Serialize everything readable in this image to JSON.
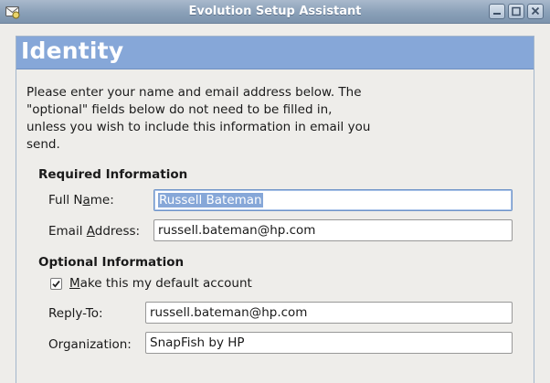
{
  "window": {
    "title": "Evolution Setup Assistant",
    "icons": {
      "app": "evolution-app-icon",
      "minimize": "minimize-icon",
      "maximize": "maximize-icon",
      "close": "close-icon"
    }
  },
  "page": {
    "title": "Identity",
    "intro_lines": [
      "Please enter your name and email address below. The",
      "\"optional\" fields below do not need to be filled in,",
      "unless you wish to include this information in email you",
      "send."
    ]
  },
  "required": {
    "heading": "Required Information",
    "full_name": {
      "label_prefix": "Full N",
      "label_mnemonic": "a",
      "label_suffix": "me:",
      "value": "Russell Bateman"
    },
    "email": {
      "label_prefix": "Email ",
      "label_mnemonic": "A",
      "label_suffix": "ddress:",
      "value": "russell.bateman@hp.com"
    }
  },
  "optional": {
    "heading": "Optional Information",
    "default_account": {
      "label_mnemonic": "M",
      "label_suffix": "ake this my default account",
      "checked": true
    },
    "reply_to": {
      "label": "Reply-To:",
      "value": "russell.bateman@hp.com"
    },
    "organization": {
      "label": "Organization:",
      "value": "SnapFish by HP"
    }
  },
  "colors": {
    "banner": "#86a7d8",
    "titlebar": "#8aa0b8",
    "background": "#eeedea",
    "selection": "#86a7d8"
  }
}
